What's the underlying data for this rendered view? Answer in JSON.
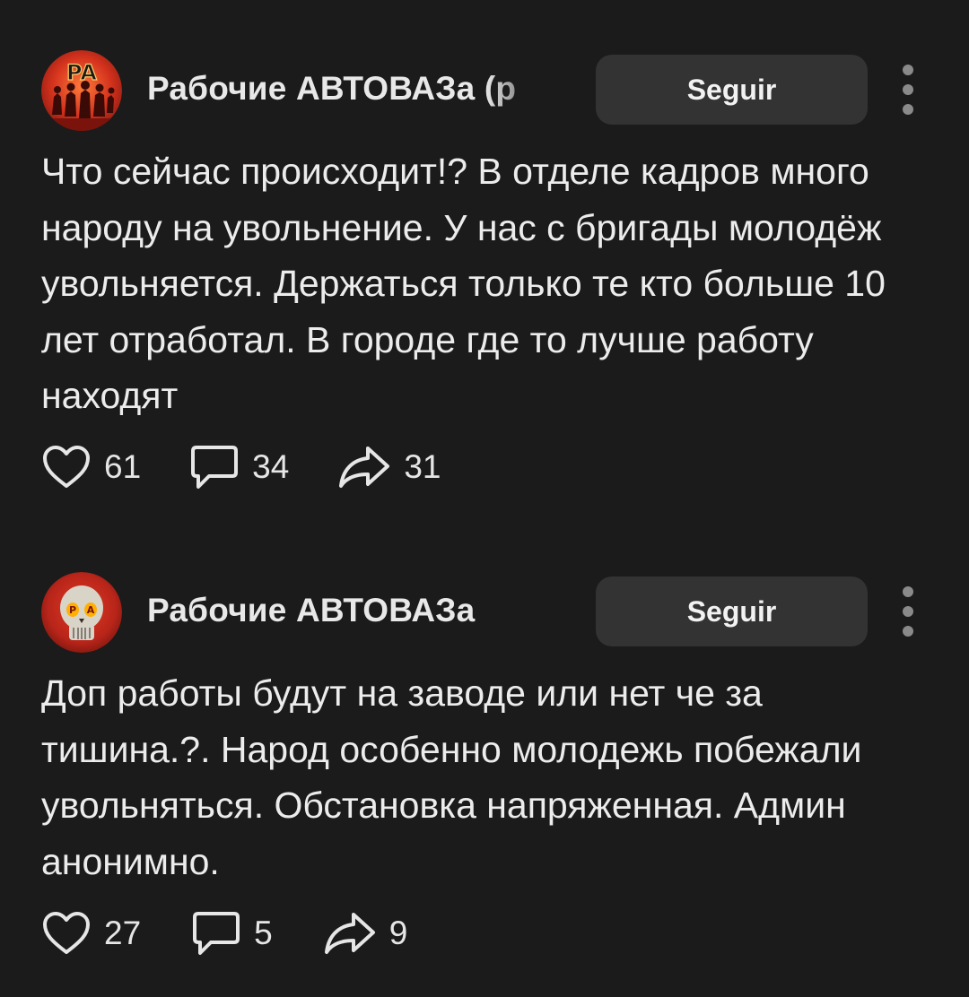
{
  "posts": [
    {
      "author": "Рабочие АВТОВАЗа (р",
      "avatar_icon": "pa-workers-logo-icon",
      "follow_label": "Seguir",
      "text": "Что сейчас происходит!? В отделе кадров много народу на увольнение. У нас с бригады молодёж увольняется. Держаться только те кто больше 10 лет отработал. В городе где то лучше работу находят",
      "likes": "61",
      "comments": "34",
      "shares": "31"
    },
    {
      "author": "Рабочие АВТОВАЗа",
      "avatar_icon": "skull-logo-icon",
      "follow_label": "Seguir",
      "text": "Доп работы будут на заводе или нет че за тишина.?. Народ особенно молодежь побежали увольняться. Обстановка напряженная. Админ анонимно.",
      "likes": "27",
      "comments": "5",
      "shares": "9"
    }
  ],
  "icons": {
    "like": "heart-icon",
    "comment": "speech-bubble-icon",
    "share": "share-arrow-icon",
    "more": "vertical-ellipsis-icon"
  },
  "colors": {
    "background": "#1b1b1b",
    "button_bg": "#333333",
    "text": "#ececec",
    "avatar_red": "#c0281c"
  }
}
